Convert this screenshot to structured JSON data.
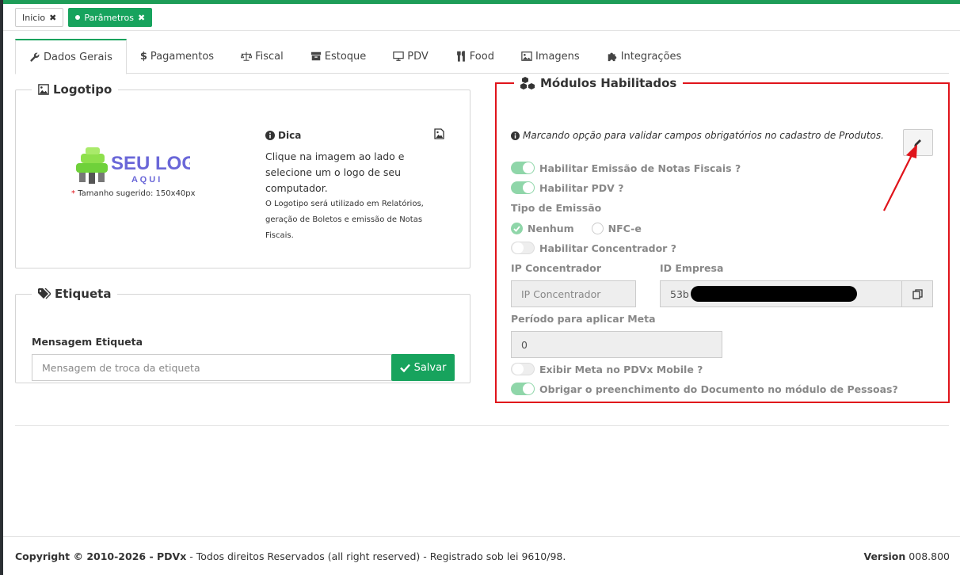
{
  "pill_tabs": [
    {
      "label": "Inicio",
      "active": false
    },
    {
      "label": "Parâmetros",
      "active": true
    }
  ],
  "tabs": [
    {
      "label": "Dados Gerais",
      "icon": "wrench-icon",
      "active": true
    },
    {
      "label": "Pagamentos",
      "icon": "dollar-icon",
      "active": false
    },
    {
      "label": "Fiscal",
      "icon": "balance-scale-icon",
      "active": false
    },
    {
      "label": "Estoque",
      "icon": "archive-icon",
      "active": false
    },
    {
      "label": "PDV",
      "icon": "monitor-icon",
      "active": false
    },
    {
      "label": "Food",
      "icon": "cutlery-icon",
      "active": false
    },
    {
      "label": "Imagens",
      "icon": "image-icon",
      "active": false
    },
    {
      "label": "Integrações",
      "icon": "puzzle-icon",
      "active": false
    }
  ],
  "logotipo": {
    "title": "Logotipo",
    "logo_main": "SEU LOGO",
    "logo_sub": "A Q U I",
    "required_mark": "*",
    "size_hint": "Tamanho sugerido: 150x40px",
    "dica_title": "Dica",
    "dica_text": "Clique na imagem ao lado e selecione um o logo de seu computador.",
    "dica_small": "O Logotipo será utilizado em Relatórios, geração de Boletos e emissão de Notas Fiscais."
  },
  "etiqueta": {
    "title": "Etiqueta",
    "field_label": "Mensagem Etiqueta",
    "placeholder": "Mensagem de troca da etiqueta",
    "save_label": "Salvar"
  },
  "modulos": {
    "title": "Módulos Habilitados",
    "info": "Marcando opção para validar campos obrigatórios no cadastro de Produtos.",
    "toggle_nfe": "Habilitar Emissão de Notas Fiscais ?",
    "toggle_pdv": "Habilitar PDV ?",
    "tipo_emissao_label": "Tipo de Emissão",
    "radio_nenhum": "Nenhum",
    "radio_nfce": "NFC-e",
    "toggle_concentrador": "Habilitar Concentrador ?",
    "ip_label": "IP Concentrador",
    "ip_placeholder": "IP Concentrador",
    "id_label": "ID Empresa",
    "id_value": "53b",
    "meta_label": "Período para aplicar Meta",
    "meta_value": "0",
    "toggle_meta_mobile": "Exibir Meta no PDVx Mobile ?",
    "toggle_documento": "Obrigar o preenchimento do Documento no módulo de Pessoas?"
  },
  "footer": {
    "copyright_prefix": "Copyright © 2010-2026 - PDVx",
    "copyright_rest": " - Todos direitos Reservados (all right reserved) - Registrado sob lei 9610/98.",
    "version_label": "Version",
    "version_value": "008.800"
  },
  "colors": {
    "brand_green": "#17a35d",
    "highlight_red": "#e0141b"
  }
}
